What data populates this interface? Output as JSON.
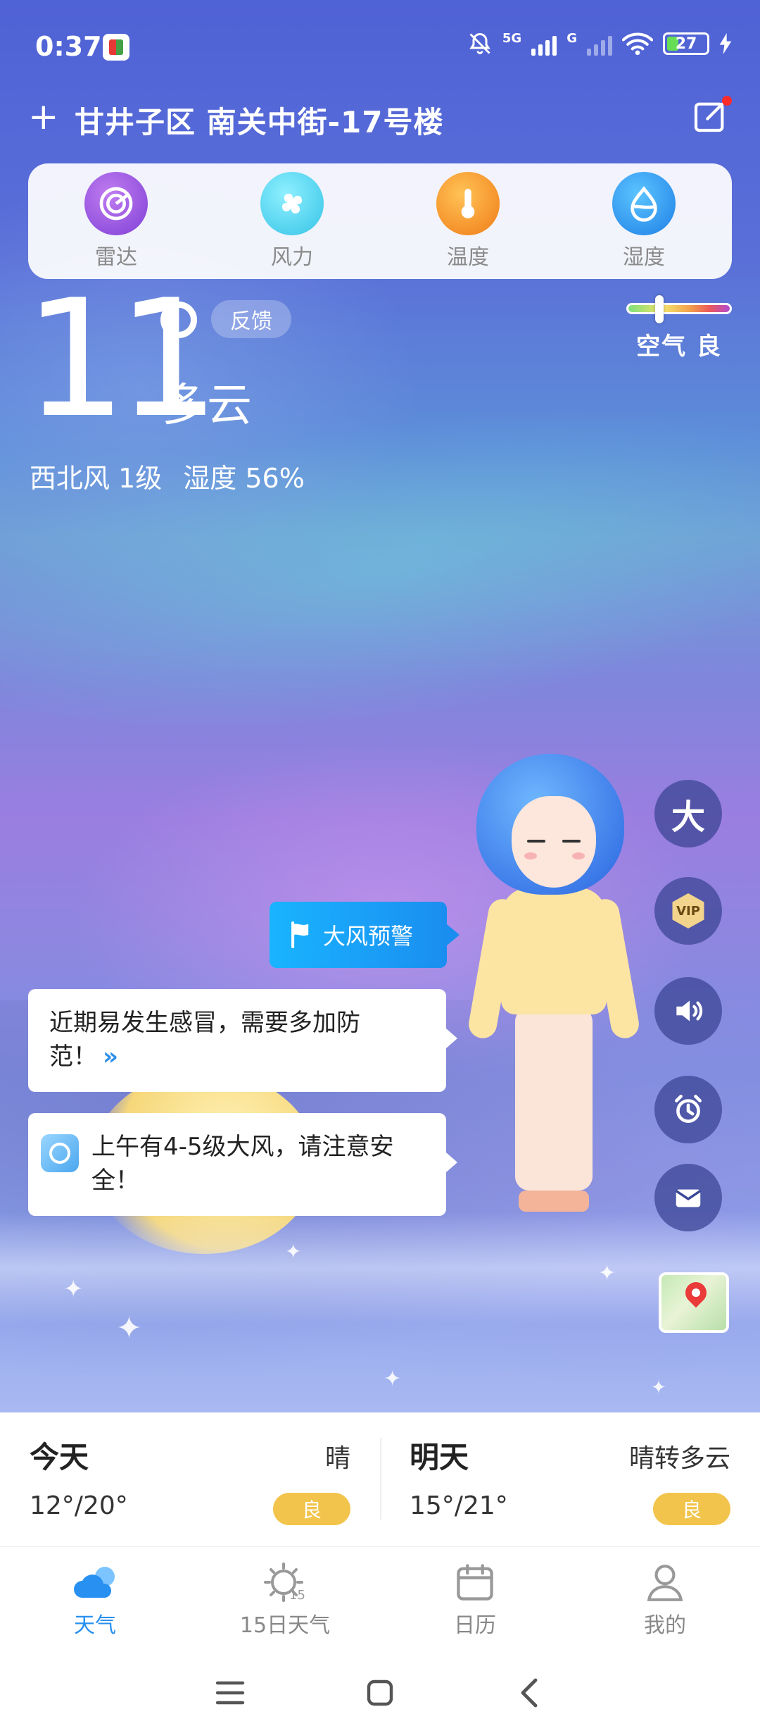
{
  "status_bar": {
    "time": "0:37",
    "network_1": "5G",
    "network_2": "G",
    "battery": "27"
  },
  "header": {
    "location": "甘井子区 南关中街-17号楼",
    "add_icon": "plus-icon",
    "edit_icon": "edit-icon"
  },
  "tools": [
    {
      "label": "雷达",
      "icon": "radar-icon",
      "color": "#8e4ae0"
    },
    {
      "label": "风力",
      "icon": "fan-icon",
      "color": "#35c3e6"
    },
    {
      "label": "温度",
      "icon": "thermometer-icon",
      "color": "#f07b15"
    },
    {
      "label": "湿度",
      "icon": "droplet-icon",
      "color": "#1f7fe6"
    }
  ],
  "current": {
    "temperature": "11",
    "feedback": "反馈",
    "condition": "多云",
    "wind": "西北风 1级",
    "humidity": "湿度 56%",
    "air_quality": "空气 良"
  },
  "side_buttons": {
    "large_font": "大",
    "vip": "VIP"
  },
  "messages": {
    "warning": "大风预警",
    "tip": "近期易发生感冒，需要多加防范！",
    "tip_more": "»",
    "alert": "上午有4-5级大风，请注意安全！"
  },
  "forecast": [
    {
      "day": "今天",
      "condition": "晴",
      "temp": "12°/20°",
      "aqi": "良"
    },
    {
      "day": "明天",
      "condition": "晴转多云",
      "temp": "15°/21°",
      "aqi": "良"
    }
  ],
  "bottom_nav": [
    {
      "label": "天气",
      "icon": "cloud-icon",
      "active": true
    },
    {
      "label": "15日天气",
      "icon": "sun-15-icon",
      "active": false
    },
    {
      "label": "日历",
      "icon": "calendar-icon",
      "active": false
    },
    {
      "label": "我的",
      "icon": "user-icon",
      "active": false
    }
  ],
  "colors": {
    "accent": "#2790f0",
    "aqi_pill": "#f2c44b",
    "warning_bubble": "#1a8ef0"
  }
}
